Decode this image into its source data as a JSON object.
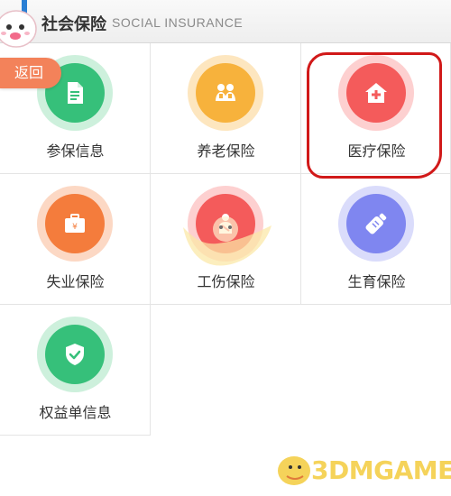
{
  "header": {
    "title": "社会保险",
    "subtitle": "SOCIAL INSURANCE"
  },
  "back_button": {
    "label": "返回"
  },
  "tiles": [
    {
      "label": "参保信息",
      "icon": "document-icon",
      "color": "#36c07a",
      "ring": "#cdf0dc"
    },
    {
      "label": "养老保险",
      "icon": "elderly-couple-icon",
      "color": "#f7b23c",
      "ring": "#fde6bf"
    },
    {
      "label": "医疗保险",
      "icon": "hospital-icon",
      "color": "#f45b5b",
      "ring": "#fdd0d0"
    },
    {
      "label": "失业保险",
      "icon": "briefcase-icon",
      "color": "#f47c3c",
      "ring": "#fcd8c4"
    },
    {
      "label": "工伤保险",
      "icon": "injury-icon",
      "color": "#f45b5b",
      "ring": "#fdd0d0"
    },
    {
      "label": "生育保险",
      "icon": "baby-bottle-icon",
      "color": "#7f86f0",
      "ring": "#dadcfb"
    },
    {
      "label": "权益单信息",
      "icon": "shield-check-icon",
      "color": "#36c07a",
      "ring": "#cdf0dc"
    }
  ],
  "watermark": {
    "text": "3DMGAME"
  }
}
